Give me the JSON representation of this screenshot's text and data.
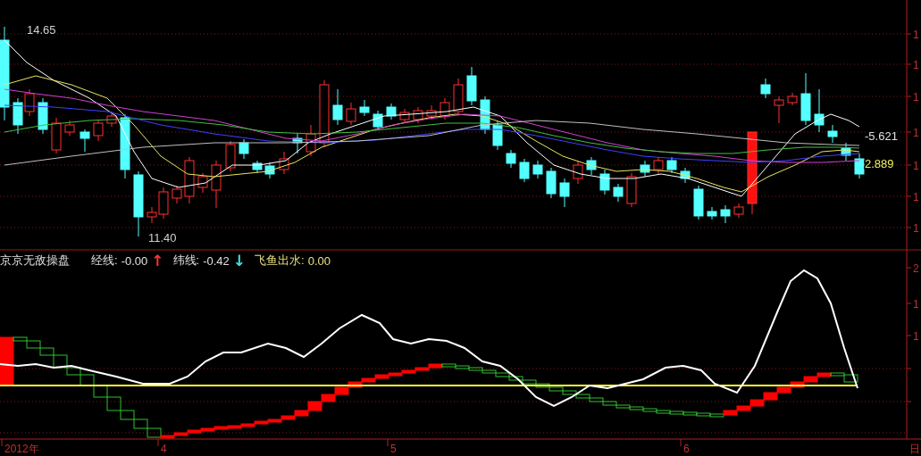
{
  "price_panel": {
    "high_label": "14.65",
    "low_label": "11.40",
    "value_labels": [
      "-5.621",
      "2.889"
    ]
  },
  "indicator_panel": {
    "name": "京京无敌操盘",
    "fields": [
      {
        "label": "经线:",
        "value": "-0.00",
        "arrow": "↑",
        "color": "#ff3030",
        "highlighted": false
      },
      {
        "label": "纬线:",
        "value": "-0.42",
        "arrow": "↓",
        "color": "#40e0e0",
        "highlighted": false
      },
      {
        "label": "飞鱼出水:",
        "value": "0.00",
        "highlighted": true
      }
    ]
  },
  "right_axis": {
    "price_labels": [
      "1",
      "1",
      "1",
      "1",
      "1",
      "1",
      "1"
    ],
    "indicator_labels": [
      "2",
      "1",
      "1"
    ]
  },
  "time_axis": {
    "labels": [
      "2012年",
      "4",
      "5",
      "6",
      "日"
    ]
  }
}
